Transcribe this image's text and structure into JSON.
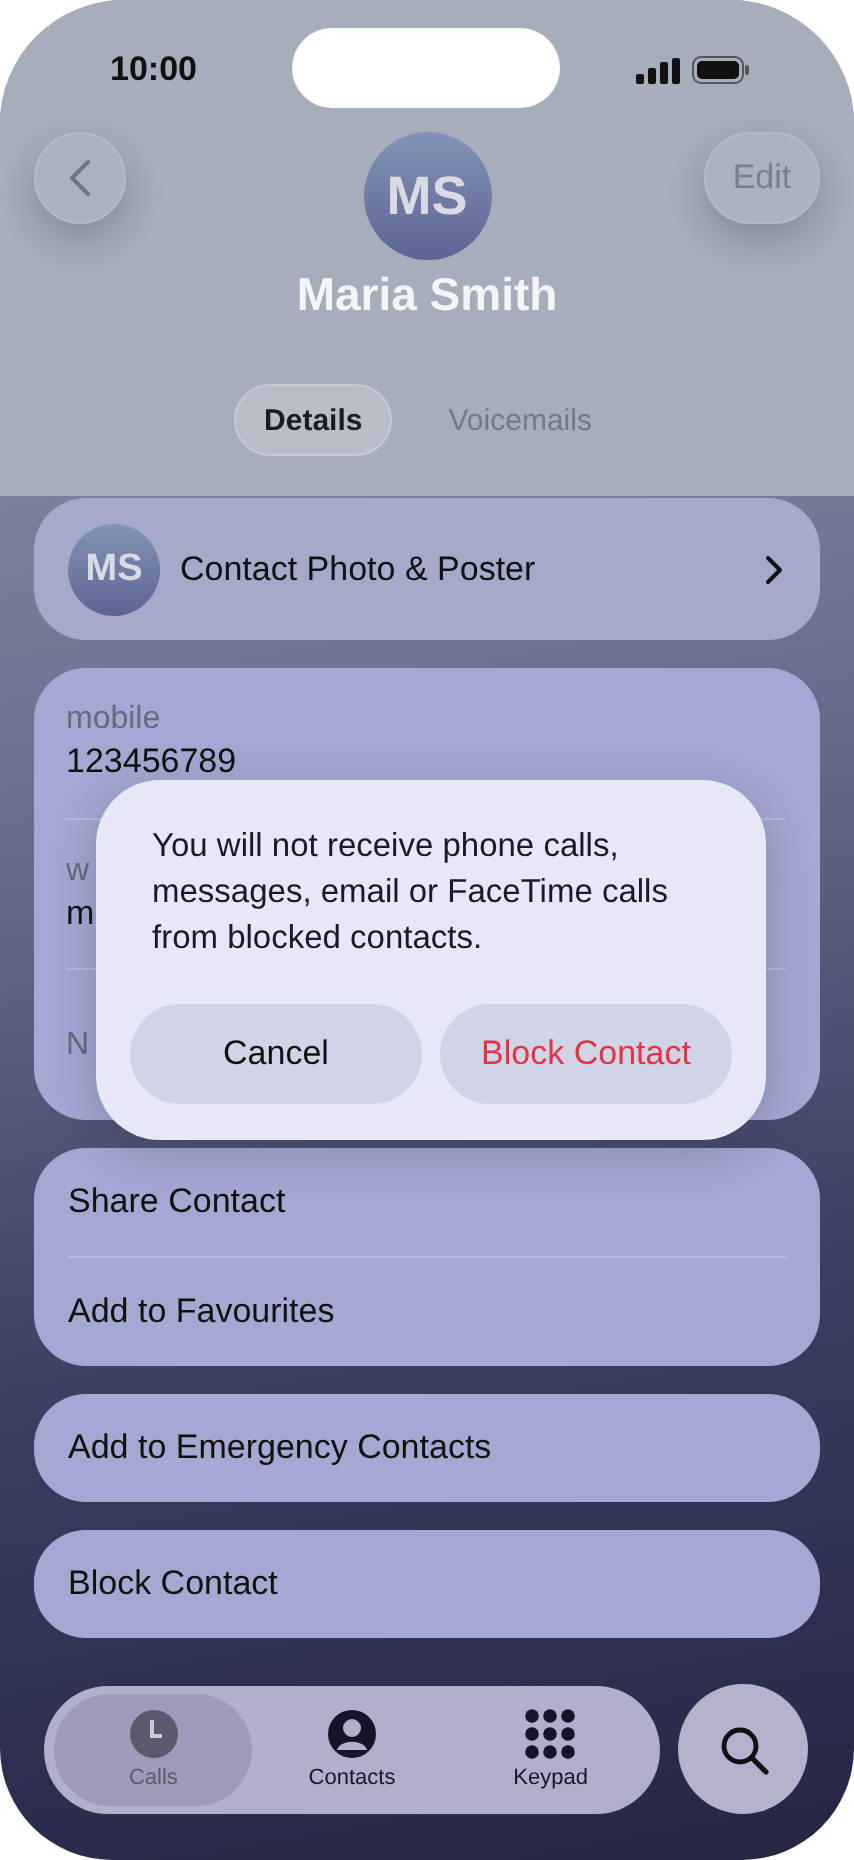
{
  "status_bar": {
    "time": "10:00"
  },
  "header": {
    "edit": "Edit",
    "initials": "MS",
    "name": "Maria Smith"
  },
  "tabs": [
    {
      "label": "Details",
      "selected": true
    },
    {
      "label": "Voicemails",
      "selected": false
    }
  ],
  "photo_row": {
    "initials": "MS",
    "label": "Contact Photo & Poster"
  },
  "fields": [
    {
      "label": "mobile",
      "value": "123456789"
    },
    {
      "label": "w",
      "value": "m"
    },
    {
      "label": "N"
    }
  ],
  "action_groups": [
    [
      "Share Contact",
      "Add to Favourites"
    ],
    [
      "Add to Emergency Contacts"
    ],
    [
      "Block Contact"
    ]
  ],
  "alert": {
    "message": "You will not receive phone calls, messages, email or FaceTime calls from blocked contacts.",
    "buttons": [
      {
        "label": "Cancel",
        "kind": "cancel"
      },
      {
        "label": "Block Contact",
        "kind": "destructive"
      }
    ]
  },
  "tab_bar": [
    {
      "label": "Calls",
      "selected": true
    },
    {
      "label": "Contacts",
      "selected": false
    },
    {
      "label": "Keypad",
      "selected": false
    }
  ]
}
